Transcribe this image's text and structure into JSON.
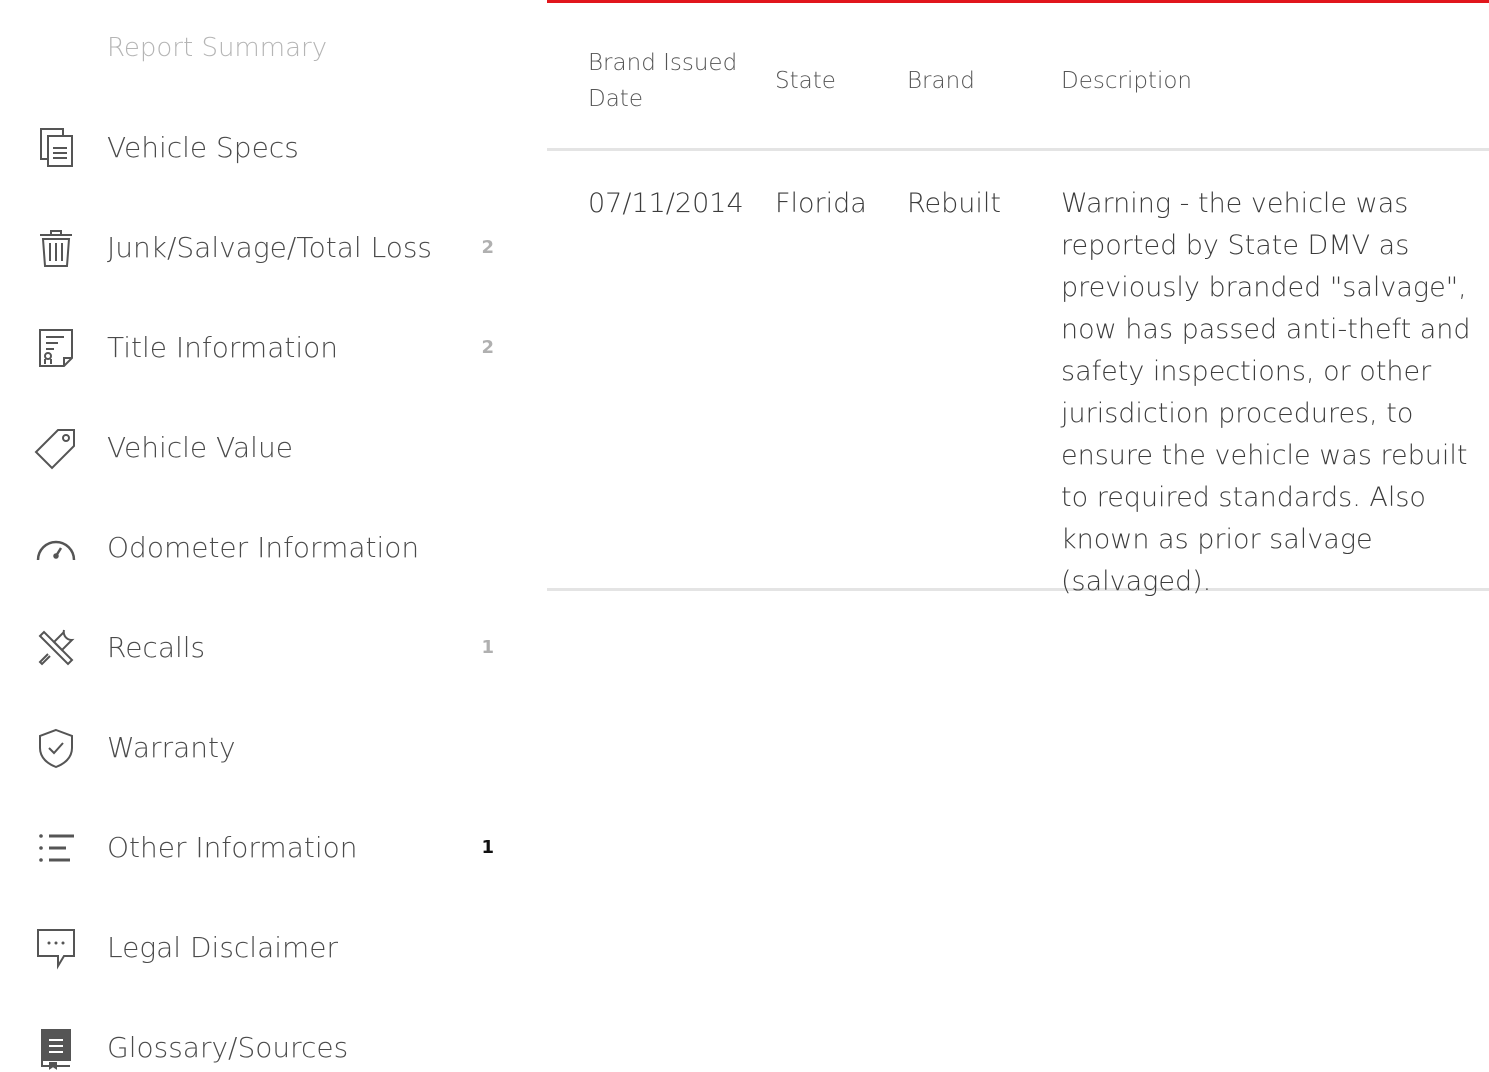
{
  "sidebar": {
    "summary_label": "Report Summary",
    "items": [
      {
        "label": "Vehicle Specs",
        "icon": "document-copy-icon",
        "badge": ""
      },
      {
        "label": "Junk/Salvage/Total Loss",
        "icon": "trash-icon",
        "badge": "2"
      },
      {
        "label": "Title Information",
        "icon": "title-certificate-icon",
        "badge": "2"
      },
      {
        "label": "Vehicle Value",
        "icon": "price-tag-icon",
        "badge": ""
      },
      {
        "label": "Odometer Information",
        "icon": "gauge-icon",
        "badge": ""
      },
      {
        "label": "Recalls",
        "icon": "tools-icon",
        "badge": "1"
      },
      {
        "label": "Warranty",
        "icon": "shield-check-icon",
        "badge": ""
      },
      {
        "label": "Other Information",
        "icon": "list-icon",
        "badge": "1"
      },
      {
        "label": "Legal Disclaimer",
        "icon": "chat-bubble-icon",
        "badge": ""
      },
      {
        "label": "Glossary/Sources",
        "icon": "book-icon",
        "badge": ""
      }
    ]
  },
  "table": {
    "accent_color": "#e1161c",
    "headers": {
      "date": "Brand Issued Date",
      "state": "State",
      "brand": "Brand",
      "description": "Description"
    },
    "rows": [
      {
        "date": "07/11/2014",
        "state": "Florida",
        "brand": "Rebuilt",
        "description": "Warning - the vehicle was reported by State DMV as previously branded \"salvage\", now has passed anti-theft and safety inspections, or other jurisdiction procedures, to ensure the vehicle was rebuilt to required standards. Also known as prior salvage (salvaged)."
      }
    ]
  }
}
